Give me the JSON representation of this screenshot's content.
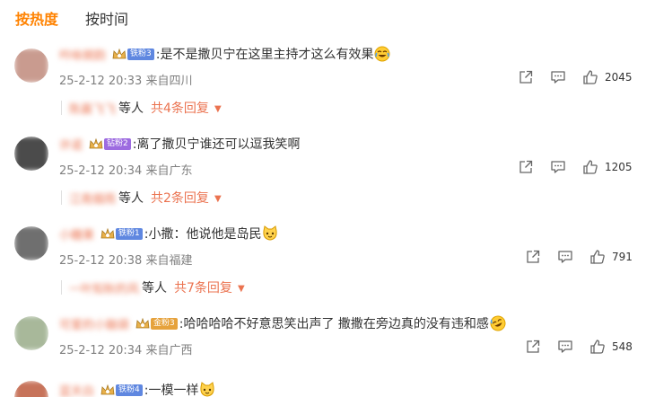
{
  "tabs": [
    {
      "label": "按热度",
      "active": true
    },
    {
      "label": "按时间",
      "active": false
    }
  ],
  "comments": [
    {
      "username": "吟咏婉韵",
      "badge": {
        "label": "铁粉3",
        "color": "#5f87e0"
      },
      "text": ":是不是撒贝宁在这里主持才这么有效果",
      "emoji": "laugh-cry-emoji",
      "meta": "25-2-12 20:33 来自四川",
      "likes": "2045",
      "reply_names": "陈晨飞飞",
      "deng": "等人",
      "reply_link": "共4条回复",
      "avatar_color": "#c99b8f"
    },
    {
      "username": "许诺",
      "badge": {
        "label": "钻粉2",
        "color": "#9d6be0"
      },
      "text": ":离了撒贝宁谁还可以逗我笑啊",
      "emoji": "",
      "meta": "25-2-12 20:34 来自广东",
      "likes": "1205",
      "reply_names": "江南烟雨",
      "deng": "等人",
      "reply_link": "共2条回复",
      "avatar_color": "#4b4b4b"
    },
    {
      "username": "小糖果",
      "badge": {
        "label": "铁粉1",
        "color": "#5f87e0"
      },
      "text": ":小撒：他说他是岛民",
      "emoji": "cat-face-emoji",
      "meta": "25-2-12 20:38 来自福建",
      "likes": "791",
      "reply_names": "一叶知秋的风",
      "deng": "等人",
      "reply_link": "共7条回复",
      "avatar_color": "#6f6f6f"
    },
    {
      "username": "可爱的小脑袋",
      "badge": {
        "label": "金粉3",
        "color": "#e6a23c"
      },
      "text": ":哈哈哈哈不好意思笑出声了 撒撒在旁边真的没有违和感",
      "emoji": "rofl-emoji",
      "meta": "25-2-12 20:34 来自广西",
      "likes": "548",
      "reply_names": "",
      "deng": "",
      "reply_link": "",
      "avatar_color": "#a8b89a"
    },
    {
      "username": "蓝天白",
      "badge": {
        "label": "铁粉4",
        "color": "#5f87e0"
      },
      "text": ":一模一样",
      "emoji": "cat-face-emoji",
      "meta": "",
      "likes": "",
      "reply_names": "",
      "deng": "",
      "reply_link": "",
      "avatar_color": "#c7735a"
    }
  ],
  "icons": {
    "share": "share-icon",
    "comment": "comment-icon",
    "like": "thumbs-up-icon",
    "reply_caret": "▼"
  },
  "colors": {
    "accent": "#ff8200",
    "link": "#eb7350",
    "meta": "#808080"
  }
}
